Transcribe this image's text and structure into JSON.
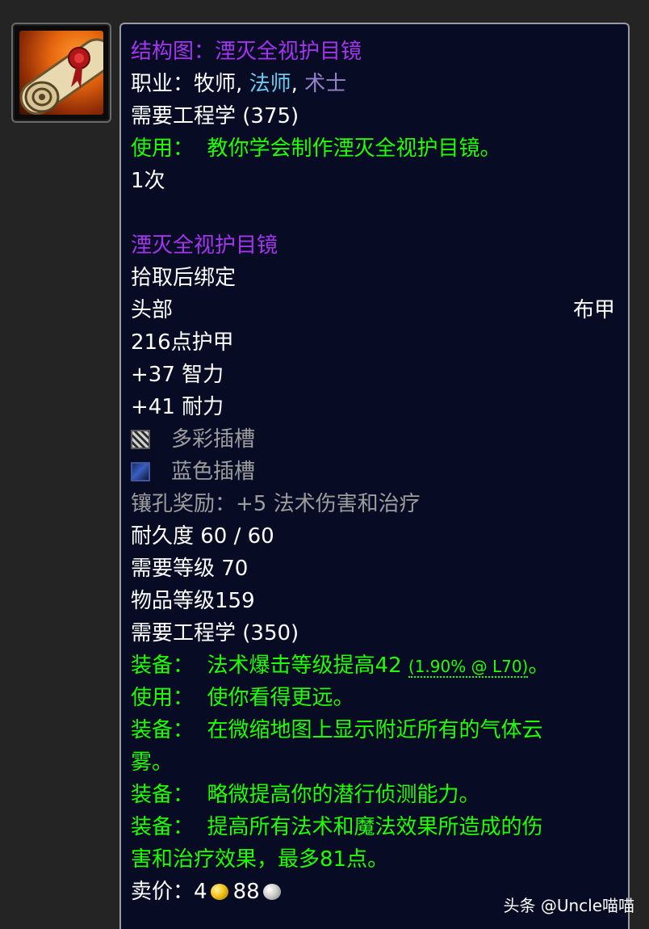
{
  "item_icon": "schematic-scroll-icon",
  "tooltip": {
    "recipe_title": "结构图：湮灭全视护目镜",
    "classes_prefix": "职业：",
    "class_priest": "牧师",
    "class_sep1": ",",
    "class_mage": "法师",
    "class_sep2": ",",
    "class_warlock": "术士",
    "recipe_requirement": "需要工程学 (375)",
    "recipe_use_label": "使用：",
    "recipe_use_text": "教你学会制作湮灭全视护目镜。",
    "charges": "1次",
    "item_name": "湮灭全视护目镜",
    "binding": "拾取后绑定",
    "slot": "头部",
    "armor_type": "布甲",
    "armor": "216点护甲",
    "stat_intellect": "+37 智力",
    "stat_stamina": "+41 耐力",
    "socket_meta_icon": "meta-socket-icon",
    "socket_meta": "多彩插槽",
    "socket_blue_icon": "blue-socket-icon",
    "socket_blue": "蓝色插槽",
    "socket_bonus": "镶孔奖励：+5 法术伤害和治疗",
    "durability": "耐久度 60 / 60",
    "required_level": "需要等级 70",
    "item_level": "物品等级159",
    "item_requirement": "需要工程学 (350)",
    "effects": [
      {
        "label": "装备：",
        "text": "法术爆击等级提高42",
        "extra": "(1.90% @ L70)",
        "tail": "。"
      },
      {
        "label": "使用：",
        "text": "使你看得更远。"
      },
      {
        "label": "装备：",
        "text": "在微缩地图上显示附近所有的气体云",
        "cont": "雾。"
      },
      {
        "label": "装备：",
        "text": "略微提高你的潜行侦测能力。"
      },
      {
        "label": "装备：",
        "text": "提高所有法术和魔法效果所造成的伤",
        "cont": "害和治疗效果，最多81点。"
      }
    ],
    "sell_label": "卖价：",
    "sell_gold": "4",
    "sell_silver": "88",
    "gold_icon": "gold-coin-icon",
    "silver_icon": "silver-coin-icon"
  },
  "watermark": "头条 @Uncle喵喵",
  "colors": {
    "epic": "#a335ee",
    "uncommon_green": "#1eff00",
    "priest": "#ffffff",
    "mage": "#69ccf0",
    "warlock": "#9482c9",
    "poor_gray": "#9d9d9d",
    "tooltip_bg": "#070b24"
  }
}
